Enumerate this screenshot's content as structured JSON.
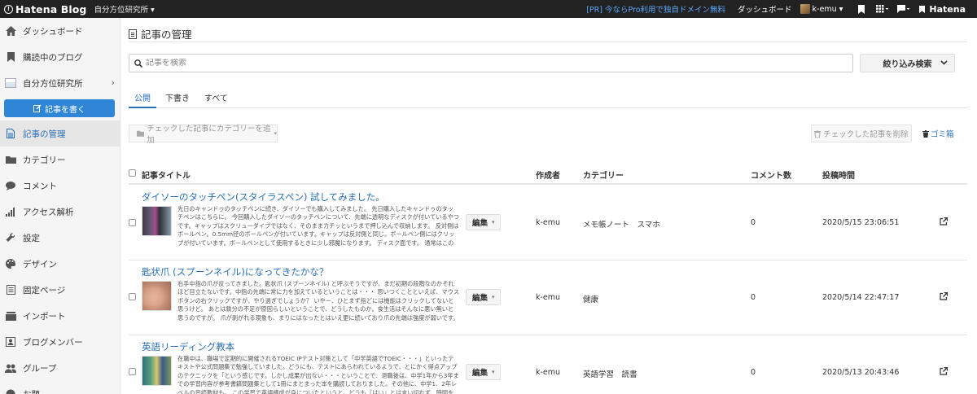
{
  "topbar": {
    "brand": "Hatena Blog",
    "blog_selector": "自分方位研究所 ▾",
    "pr_link": "[PR] 今ならPro利用で独自ドメイン無料",
    "dashboard": "ダッシュボード",
    "user": "k-emu ▾",
    "hatena": "Hatena"
  },
  "sidebar": {
    "items": [
      {
        "label": "ダッシュボード",
        "icon": "home-icon"
      },
      {
        "label": "購読中のブログ",
        "icon": "bookmark-icon"
      },
      {
        "label": "自分方位研究所",
        "icon": "blog-thumbnail-icon"
      },
      {
        "label": "記事の管理",
        "icon": "document-icon"
      },
      {
        "label": "カテゴリー",
        "icon": "folder-icon"
      },
      {
        "label": "コメント",
        "icon": "comment-icon"
      },
      {
        "label": "アクセス解析",
        "icon": "bar-chart-icon"
      },
      {
        "label": "設定",
        "icon": "wrench-icon"
      },
      {
        "label": "デザイン",
        "icon": "palette-icon"
      },
      {
        "label": "固定ページ",
        "icon": "page-icon"
      },
      {
        "label": "インポート",
        "icon": "import-icon"
      },
      {
        "label": "ブログメンバー",
        "icon": "members-icon"
      },
      {
        "label": "グループ",
        "icon": "group-icon"
      },
      {
        "label": "お題",
        "icon": "topic-icon"
      }
    ],
    "write_button": "記事を書く"
  },
  "main": {
    "title": "記事の管理",
    "search_placeholder": "記事を検索",
    "filter_button": "絞り込み検索",
    "tabs": [
      "公開",
      "下書き",
      "すべて"
    ],
    "bulk_category_button": "チェックした記事にカテゴリーを追加",
    "delete_button": "チェックした記事を削除",
    "trash_link": "ゴミ箱",
    "columns": {
      "title": "記事タイトル",
      "author": "作成者",
      "category": "カテゴリー",
      "comments": "コメント数",
      "posted": "投稿時間"
    },
    "edit_label": "編集",
    "rows": [
      {
        "title": "ダイソーのタッチペン(スタイラスペン) 試してみました。",
        "excerpt": "先日のキャンドゥのタッチペンに続き、ダイソーでも購入してみました。 先日購入したキャンドゥのタッチペンはこちらに。 今回購入したダイソーのタッチペンについて、先端に透明なディスクが付いているやつです。キャップはスクリューダイプではなく、そのままカチッというまで押し込んで収納します。 反対側はボールペン。0.5mm径のボールペンが付いています。キャップは反対側と同じ。ボールペン側にはクリップが付いています。ボールペンとして使用するときに少し邪魔になります。 ディスク面です。 通常はこのようにディスク面はペンの軸に対して水平になっています。 使うときはフレキシブルに動きます。液晶面での使用もならら…",
        "author": "k-emu",
        "category": "メモ帳ノート　スマホ",
        "comments": "0",
        "posted": "2020/5/15 23:06:51"
      },
      {
        "title": "匙状爪 (スプーンネイル)になってきたかな？",
        "excerpt": "右手中指の爪が反ってきました。匙状爪 (スプーンネイル) と呼ぶそうですが、まだ初期の段階なのかそれほど目立たないです。中指の先端に常に力を加えているということは・・・ 思いつくことといえば、マウスボタンの右クリックですが、やり過ぎでしょうか？ いやー、ひとまず指どには機能はクリックしてないと思うけど。 あとは鉄分の不足が原因らしいということで、どうしたものか。食生活はそんなに悪い無いと思うのですが。 爪が剥がれる現象も、まりにはなったとはいえ更に続いており爪の先端は強度が弱いです。 思いつくことがあるとすれば、最近、鉄裁でお茶をいれていないということぐらいでしょうか。あとは・・ おやつに甘いもの…",
        "author": "k-emu",
        "category": "健康",
        "comments": "0",
        "posted": "2020/5/14 22:47:17"
      },
      {
        "title": "英語リーディング教本",
        "excerpt": "在職中は、職場で定期的に開催されるTOEIC IPテスト対策として「中学英語でTOEIC・・・」といったテキストや公式問題集で勉強していました。どうにも、テストにあらわれているようで、とにかく得点アップのテクニックを「という感じです。しかし成果が出ない・・・ということで、退職後は、中学1年から3年までの学習内容が参考書籍問題集として1冊にまとまった本を購読しておりました。その他に、中学1、2年レベルの音読教材も。 この学習で英語構成が身についたというと、どうも『はい』とは言い切れず、時間をかけている割には身のいく成果が出ているとは思えません。学習教材以前に、学習のやり方にも問題があるのだと…",
        "author": "k-emu",
        "category": "英語学習　読書",
        "comments": "0",
        "posted": "2020/5/13 20:43:46"
      }
    ]
  },
  "colors": {
    "topbar_bg": "#222222",
    "accent": "#2a6fb6",
    "write_button": "#2f86d6"
  }
}
